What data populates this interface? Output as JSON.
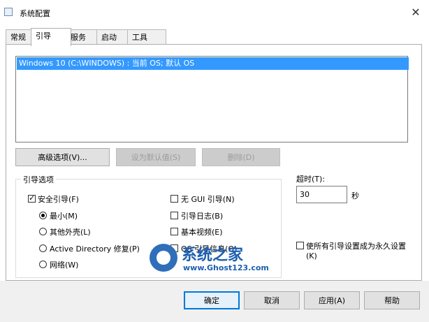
{
  "window": {
    "title": "系统配置",
    "close_label": "✕"
  },
  "tabs": [
    {
      "label": "常规"
    },
    {
      "label": "引导"
    },
    {
      "label": "服务"
    },
    {
      "label": "启动"
    },
    {
      "label": "工具"
    }
  ],
  "os_list": {
    "items": [
      "Windows 10 (C:\\WINDOWS) : 当前 OS; 默认 OS"
    ]
  },
  "os_buttons": {
    "advanced": "高级选项(V)...",
    "set_default": "设为默认值(S)",
    "delete": "删除(D)"
  },
  "boot_options": {
    "group_label": "引导选项",
    "safe_boot": "安全引导(F)",
    "minimal": "最小(M)",
    "alternate_shell": "其他外壳(L)",
    "active_directory": "Active Directory 修复(P)",
    "network": "网络(W)",
    "no_gui": "无 GUI 引导(N)",
    "boot_log": "引导日志(B)",
    "base_video": "基本视频(E)",
    "os_boot_info": "OS 引导信息(O)"
  },
  "timeout": {
    "label": "超时(T):",
    "value": "30",
    "unit": "秒"
  },
  "permanent": {
    "label_line1": "使所有引导设置成为永久设置",
    "label_line2": "(K)"
  },
  "watermark": {
    "big": "系统之家",
    "small": "www.Ghost123.com"
  },
  "footer": {
    "ok": "确定",
    "cancel": "取消",
    "apply": "应用(A)",
    "help": "帮助"
  }
}
